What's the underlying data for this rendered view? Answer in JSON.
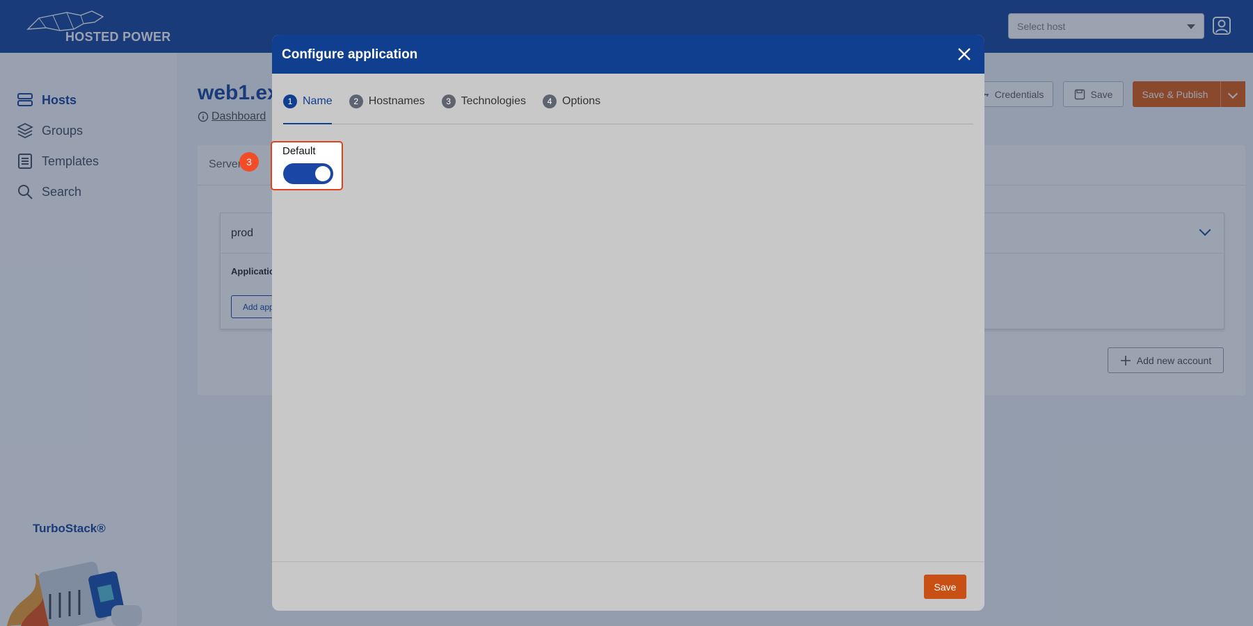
{
  "app": {
    "logo_text": "HOSTED POWER",
    "host_select_placeholder": "Select host",
    "brand": "TurboStack®"
  },
  "sidebar": {
    "items": [
      {
        "label": "Hosts",
        "icon": "server-stack-icon",
        "active": true
      },
      {
        "label": "Groups",
        "icon": "layers-icon",
        "active": false
      },
      {
        "label": "Templates",
        "icon": "document-list-icon",
        "active": false
      },
      {
        "label": "Search",
        "icon": "search-icon",
        "active": false
      }
    ]
  },
  "main": {
    "title": "web1.ex",
    "breadcrumb": "Dashboard",
    "buttons": {
      "credentials": "Credentials",
      "save": "Save",
      "save_publish": "Save & Publish"
    },
    "tab": "Server",
    "account": {
      "name": "prod",
      "section_label": "Applicatic",
      "add_app_button": "Add app"
    },
    "add_account_button": "Add new account"
  },
  "modal": {
    "title": "Configure application",
    "steps": [
      {
        "number": "1",
        "label": "Name",
        "active": true
      },
      {
        "number": "2",
        "label": "Hostnames",
        "active": false
      },
      {
        "number": "3",
        "label": "Technologies",
        "active": false
      },
      {
        "number": "4",
        "label": "Options",
        "active": false
      }
    ],
    "default_label": "Default",
    "default_enabled": true,
    "annotation_badge": "3",
    "save_button": "Save"
  },
  "colors": {
    "primary": "#113f8f",
    "accent": "#c85014",
    "highlight": "#e0411b",
    "toggle_on": "#1a47a6"
  }
}
